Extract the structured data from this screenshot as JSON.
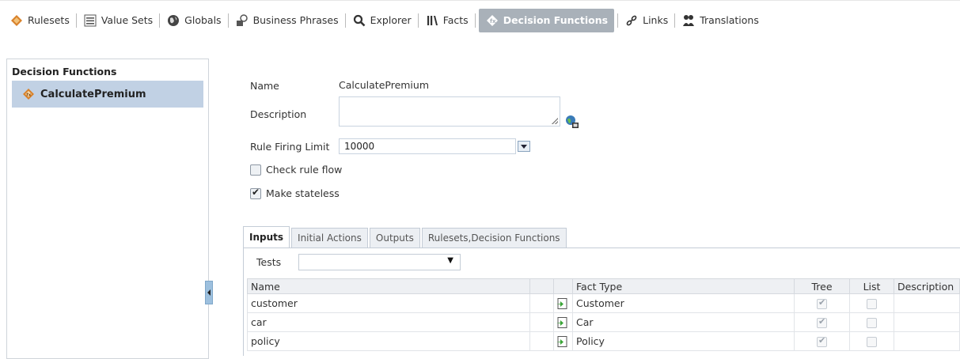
{
  "toolbar": {
    "items": [
      {
        "label": "Rulesets",
        "icon": "rulesets-icon"
      },
      {
        "label": "Value Sets",
        "icon": "value-sets-icon"
      },
      {
        "label": "Globals",
        "icon": "globe-icon"
      },
      {
        "label": "Business Phrases",
        "icon": "business-phrases-icon"
      },
      {
        "label": "Explorer",
        "icon": "search-icon"
      },
      {
        "label": "Facts",
        "icon": "facts-icon"
      },
      {
        "label": "Decision Functions",
        "icon": "decision-functions-icon",
        "active": true
      },
      {
        "label": "Links",
        "icon": "link-icon"
      },
      {
        "label": "Translations",
        "icon": "translations-icon"
      }
    ]
  },
  "sidebar": {
    "title": "Decision Functions",
    "items": [
      {
        "label": "CalculatePremium",
        "selected": true
      }
    ]
  },
  "form": {
    "name_label": "Name",
    "name_value": "CalculatePremium",
    "description_label": "Description",
    "description_value": "",
    "limit_label": "Rule Firing Limit",
    "limit_value": "10000",
    "check_rule_flow_label": "Check rule flow",
    "check_rule_flow_checked": false,
    "make_stateless_label": "Make stateless",
    "make_stateless_checked": true
  },
  "tabs": [
    {
      "label": "Inputs",
      "active": true
    },
    {
      "label": "Initial Actions"
    },
    {
      "label": "Outputs"
    },
    {
      "label": "Rulesets,Decision Functions"
    }
  ],
  "tests": {
    "label": "Tests",
    "value": ""
  },
  "inputs_table": {
    "headers": {
      "name": "Name",
      "fact_type": "Fact Type",
      "tree": "Tree",
      "list": "List",
      "description": "Description"
    },
    "rows": [
      {
        "name": "customer",
        "fact_type": "Customer",
        "tree": true,
        "list": false,
        "description": ""
      },
      {
        "name": "car",
        "fact_type": "Car",
        "tree": true,
        "list": false,
        "description": ""
      },
      {
        "name": "policy",
        "fact_type": "Policy",
        "tree": true,
        "list": false,
        "description": ""
      }
    ]
  },
  "colors": {
    "active_tab_bg": "#a9b1b9",
    "selected_item_bg": "#c1d1e4"
  }
}
